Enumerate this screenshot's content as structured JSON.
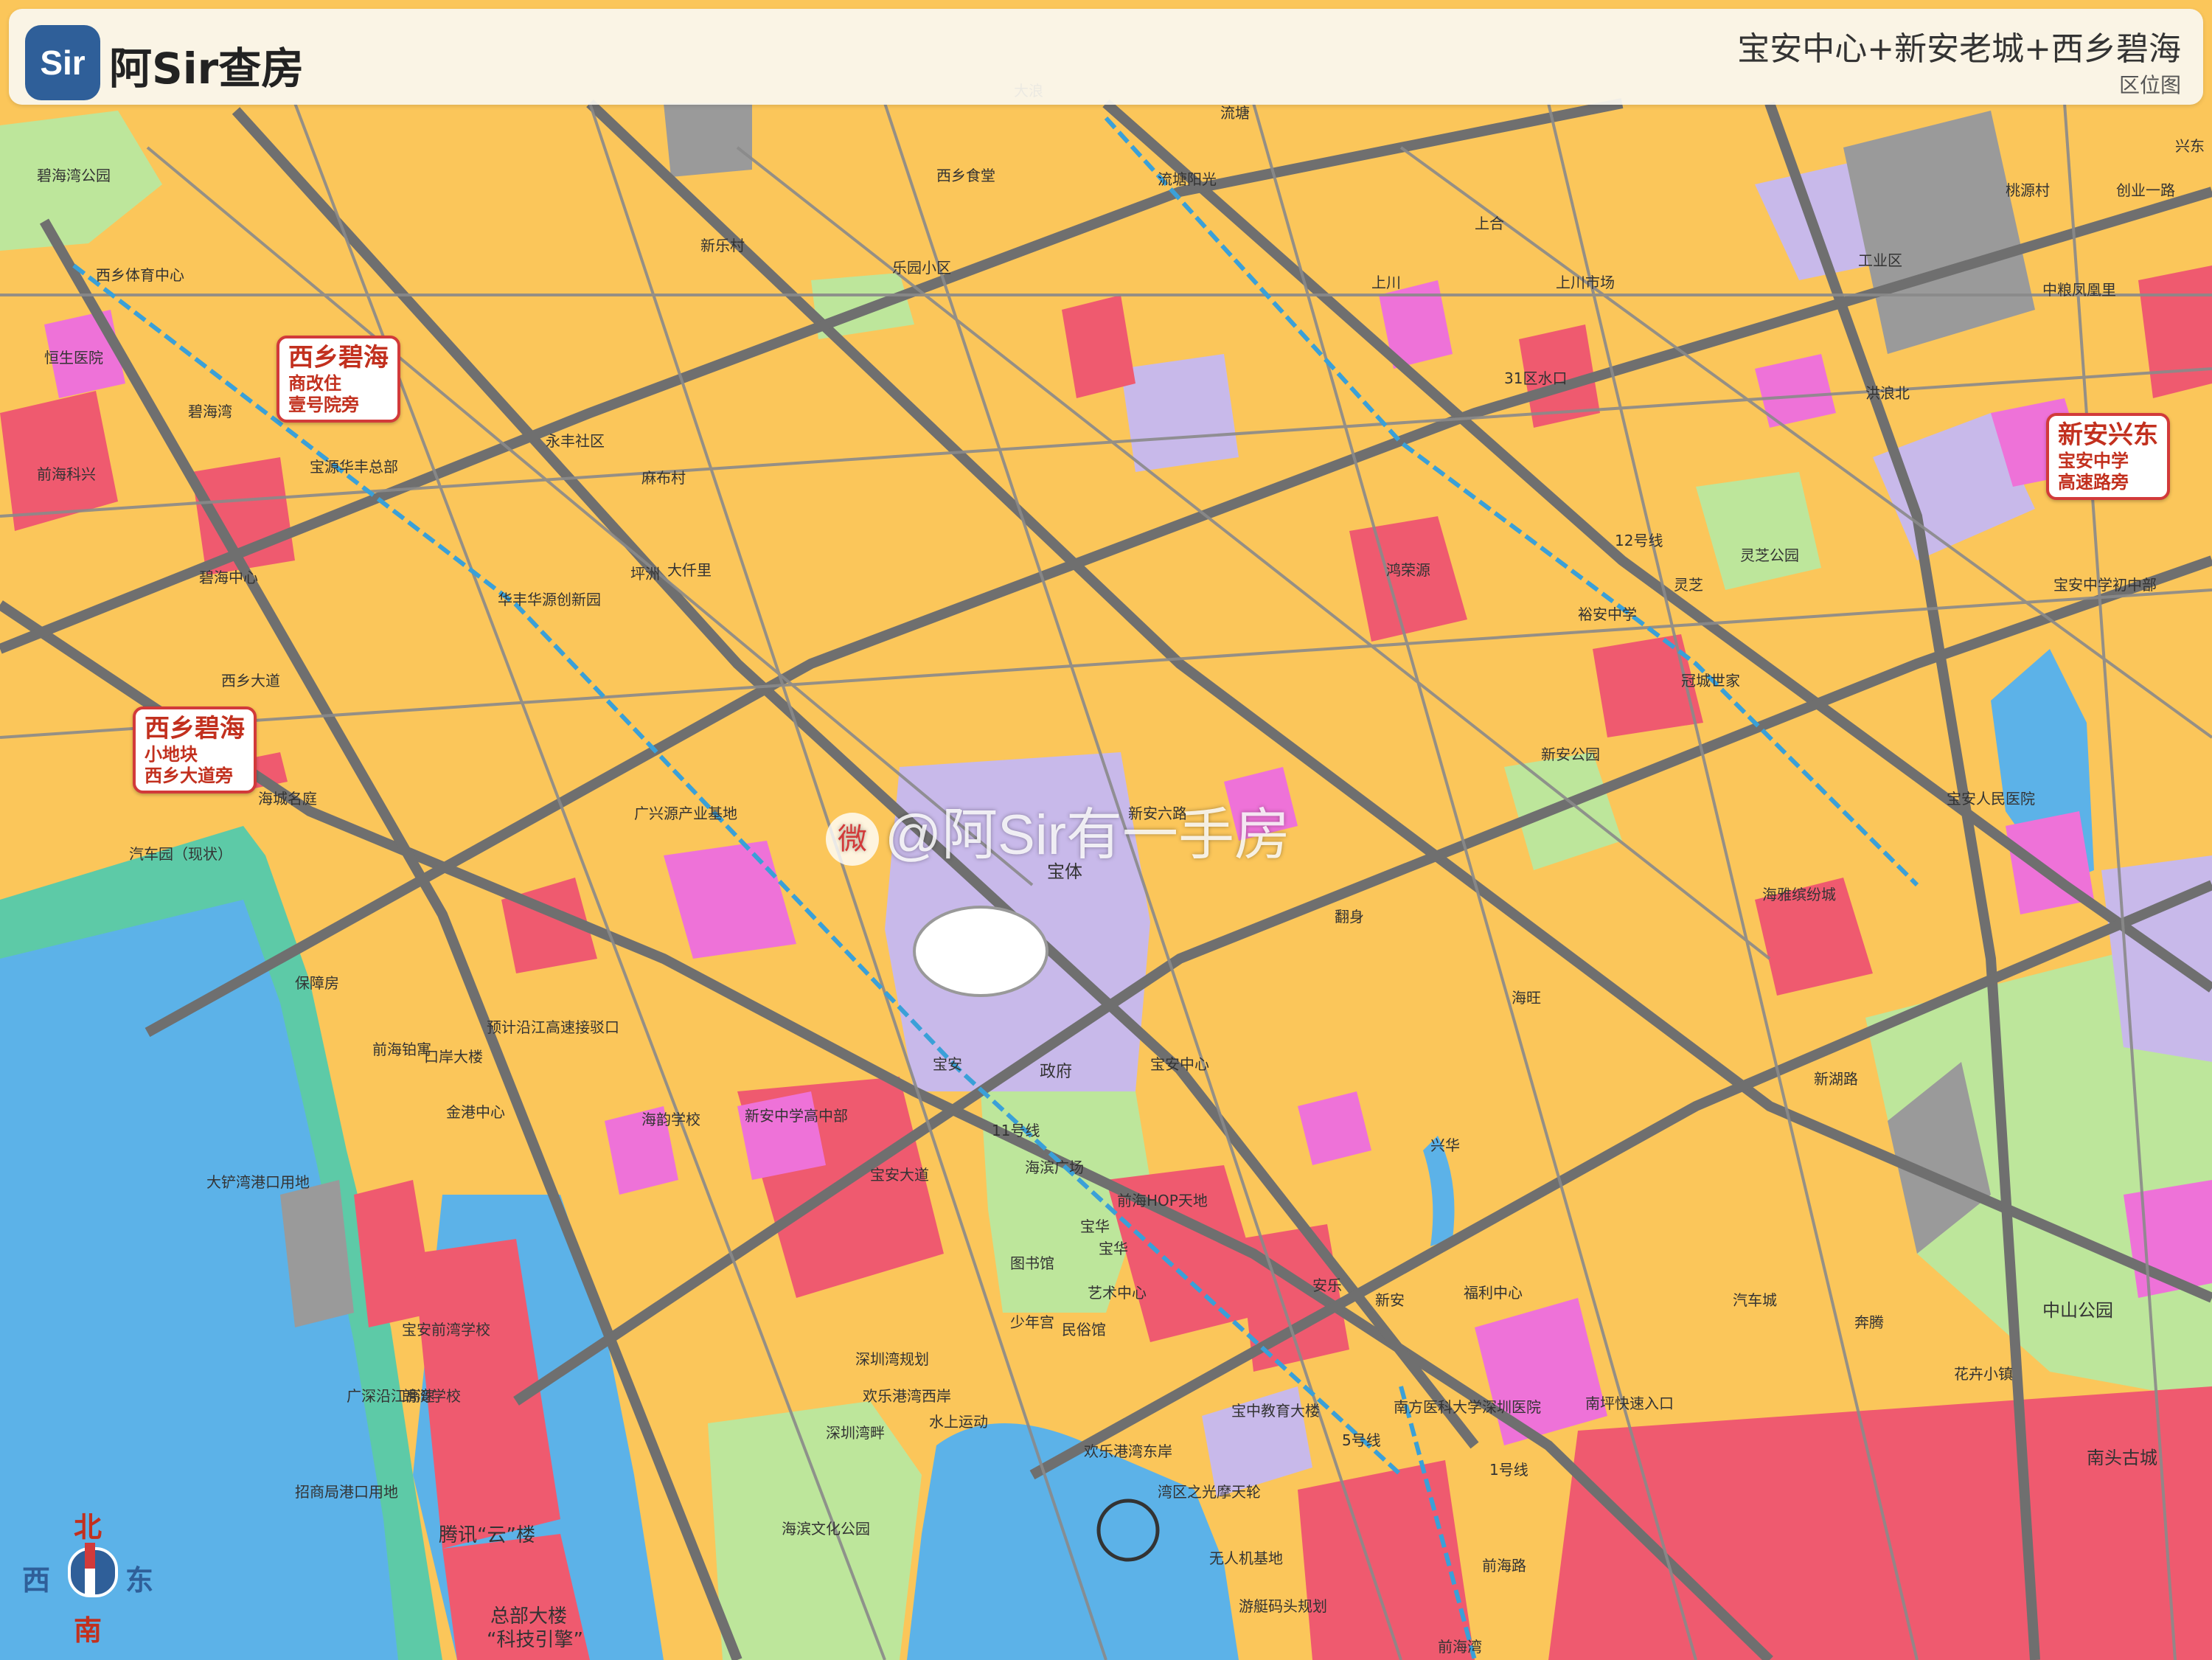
{
  "header": {
    "logo_text": "Sir",
    "brand": "阿Sir查房",
    "title": "宝安中心+新安老城+西乡碧海",
    "subtitle": "区位图"
  },
  "colors": {
    "residential": "#fbc65a",
    "commercial": "#ef5a6f",
    "education": "#ee72d8",
    "public_facility": "#c8b9ea",
    "park": "#bde69b",
    "water": "#5cb2e8",
    "sea_green": "#5dcaa7",
    "industrial": "#9a9a9a",
    "accent_red": "#d23a3a",
    "brand_blue": "#2f5f99"
  },
  "callouts": [
    {
      "title": "西乡碧海",
      "lines": [
        "商改住",
        "壹号院旁"
      ]
    },
    {
      "title": "西乡碧海",
      "lines": [
        "小地块",
        "西乡大道旁"
      ]
    },
    {
      "title": "新安兴东",
      "lines": [
        "宝安中学",
        "高速路旁"
      ]
    }
  ],
  "watermark": {
    "text": "@阿Sir有一手房",
    "badge": "微"
  },
  "compass": {
    "north": "北",
    "south": "南",
    "west": "西",
    "east": "东"
  },
  "labels": {
    "l1": "碧海湾公园",
    "l2": "西乡体育中心",
    "l3": "恒生医院",
    "l4": "碧海湾",
    "l5": "碧海中心",
    "l6": "前海科兴",
    "l7": "宝源华丰总部",
    "l8": "海城名庭",
    "l9": "汽车园（现状）",
    "l10": "保障房",
    "l11": "前海铂寓",
    "l12": "口岸大楼",
    "l13": "大铲湾港口用地",
    "l14": "朗湾学校",
    "l15": "宝安前湾学校",
    "l16": "腾讯“云”楼",
    "l17": "总部大楼",
    "l18": "“科技引擎”",
    "l19": "招商局港口用地",
    "l20": "金港中心",
    "l21": "海韵学校",
    "l22": "新安中学高中部",
    "l23": "宝体",
    "l24": "宝安",
    "l25": "政府",
    "l26": "海滨广场",
    "l27": "欢乐港湾西岸",
    "l28": "水上运动",
    "l29": "欢乐港湾东岸",
    "l30": "海滨文化公园",
    "l31": "湾区之光摩天轮",
    "l32": "无人机基地",
    "l33": "游艇码头规划",
    "l34": "南方医科大学深圳医院",
    "l35": "宝中教育大楼",
    "l36": "福利中心",
    "l37": "安乐",
    "l38": "新安",
    "l39": "宝华",
    "l40": "宝安中心",
    "l41": "前海HOP天地",
    "l42": "深圳湾畔",
    "l43": "新安公园",
    "l44": "海雅缤纷城",
    "l45": "宝安人民医院",
    "l46": "灵芝公园",
    "l47": "裕安中学",
    "l48": "冠城世家",
    "l49": "翻身",
    "l50": "洪浪北",
    "l51": "兴东",
    "l52": "工业区",
    "l53": "中山公园",
    "l54": "南头古城",
    "l55": "花卉小镇",
    "l56": "南坪快速入口",
    "l57": "汽车城",
    "l58": "奔腾",
    "l59": "前海湾",
    "l60": "广兴源产业基地",
    "l61": "大仟里",
    "l62": "华丰华源创新园",
    "l63": "坪洲",
    "l64": "鸿荣源",
    "l65": "上川",
    "l66": "新乐村",
    "l67": "永丰社区",
    "l68": "麻布村",
    "l69": "流塘",
    "l70": "宝安大道",
    "l71": "新安六路",
    "l72": "1号线",
    "l73": "11号线",
    "l74": "12号线",
    "l75": "5号线",
    "l76": "广深沿江高速",
    "l77": "前海路",
    "l78": "新湖路",
    "l79": "创业一路",
    "l80": "桃源村",
    "l81": "上合",
    "l82": "西乡大道",
    "l83": "海旺",
    "l84": "灵芝",
    "l85": "兴华",
    "l86": "中粮凤凰里",
    "l87": "宝安中学初中部",
    "l88": "31区水口",
    "l89": "上川市场",
    "l90": "流塘阳光",
    "l91": "西乡食堂",
    "l92": "乐园小区",
    "l93": "宝华",
    "l94": "大浪",
    "l95": "艺术中心",
    "l96": "图书馆",
    "l97": "少年宫",
    "l98": "民俗馆",
    "l99": "深圳湾规划",
    "l100": "预计沿江高速接驳口"
  }
}
